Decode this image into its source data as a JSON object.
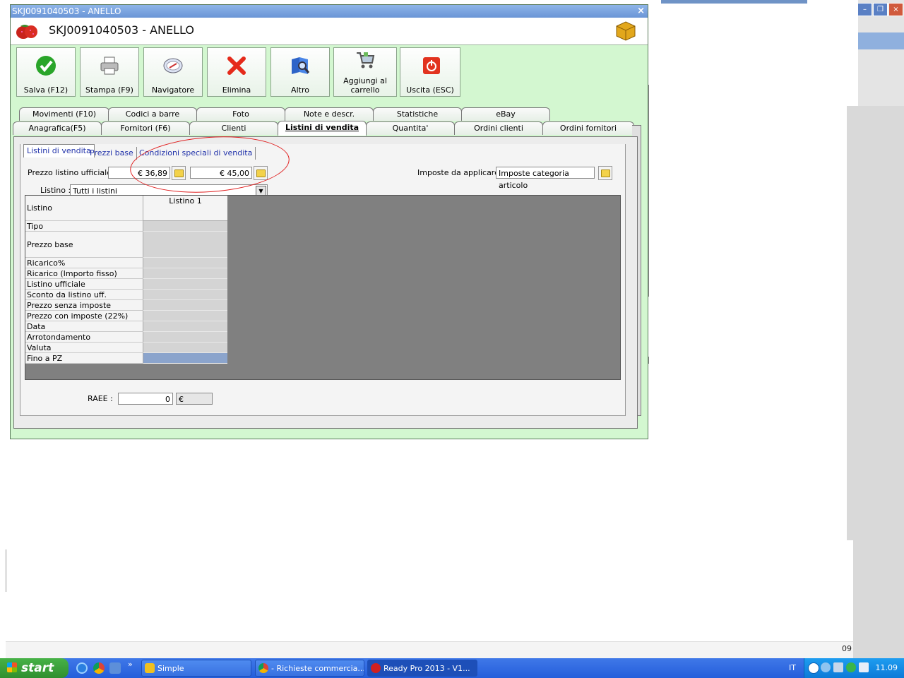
{
  "window": {
    "title": "SKJ0091040503 - ANELLO",
    "header_title": "SKJ0091040503 - ANELLO",
    "close": "×"
  },
  "toolbar": [
    {
      "label": "Salva (F12)",
      "icon": "check-icon"
    },
    {
      "label": "Stampa (F9)",
      "icon": "printer-icon"
    },
    {
      "label": "Navigatore",
      "icon": "compass-icon"
    },
    {
      "label": "Elimina",
      "icon": "delete-x-icon"
    },
    {
      "label": "Altro",
      "icon": "magnifier-book-icon"
    },
    {
      "label": "Aggiungi al carrello",
      "icon": "cart-icon"
    },
    {
      "label": "Uscita (ESC)",
      "icon": "power-icon"
    }
  ],
  "tabs_row1": [
    "Movimenti (F10)",
    "Codici a barre",
    "Foto",
    "Note e descr.",
    "Statistiche",
    "eBay"
  ],
  "tabs_row2": [
    "Anagrafica(F5)",
    "Fornitori (F6)",
    "Clienti",
    "Listini di vendita",
    "Quantita'",
    "Ordini clienti",
    "Ordini fornitori"
  ],
  "active_tab": "Listini di vendita",
  "subtabs": [
    "Listini di vendita",
    "Prezzi base",
    "Condizioni speciali di vendita"
  ],
  "form": {
    "prezzo_label": "Prezzo listino ufficiale :",
    "prezzo_value1": "€ 36,89",
    "prezzo_value2": "€ 45,00",
    "imposte_label": "Imposte da applicare :",
    "imposte_value": "Imposte categoria articolo",
    "listino_label": "Listino :",
    "listino_value": "Tutti i listini",
    "raee_label": "RAEE :",
    "raee_value": "0",
    "raee_currency": "€"
  },
  "grid": {
    "header_row_label": "Listino",
    "column": "Listino 1",
    "rows": [
      "Tipo",
      "Prezzo base",
      "Ricarico%",
      "Ricarico (Importo fisso)",
      "Listino ufficiale",
      "Sconto da listino uff.",
      "Prezzo senza imposte",
      "Prezzo con imposte (22%)",
      "Data",
      "Arrotondamento",
      "Valuta",
      "Fino a PZ"
    ]
  },
  "background": {
    "status_text": "09"
  },
  "taskbar": {
    "start": "start",
    "quick_more": "»",
    "tasks": [
      "Simple",
      "- Richieste commercia...",
      "Ready Pro 2013 - V1..."
    ],
    "lang": "IT",
    "clock": "11.09"
  },
  "colors": {
    "window_bg": "#d3f7d0",
    "titlebar": "#6a95d6",
    "annotation": "#e02020",
    "taskbar": "#245edb",
    "start": "#2f8f2f"
  }
}
